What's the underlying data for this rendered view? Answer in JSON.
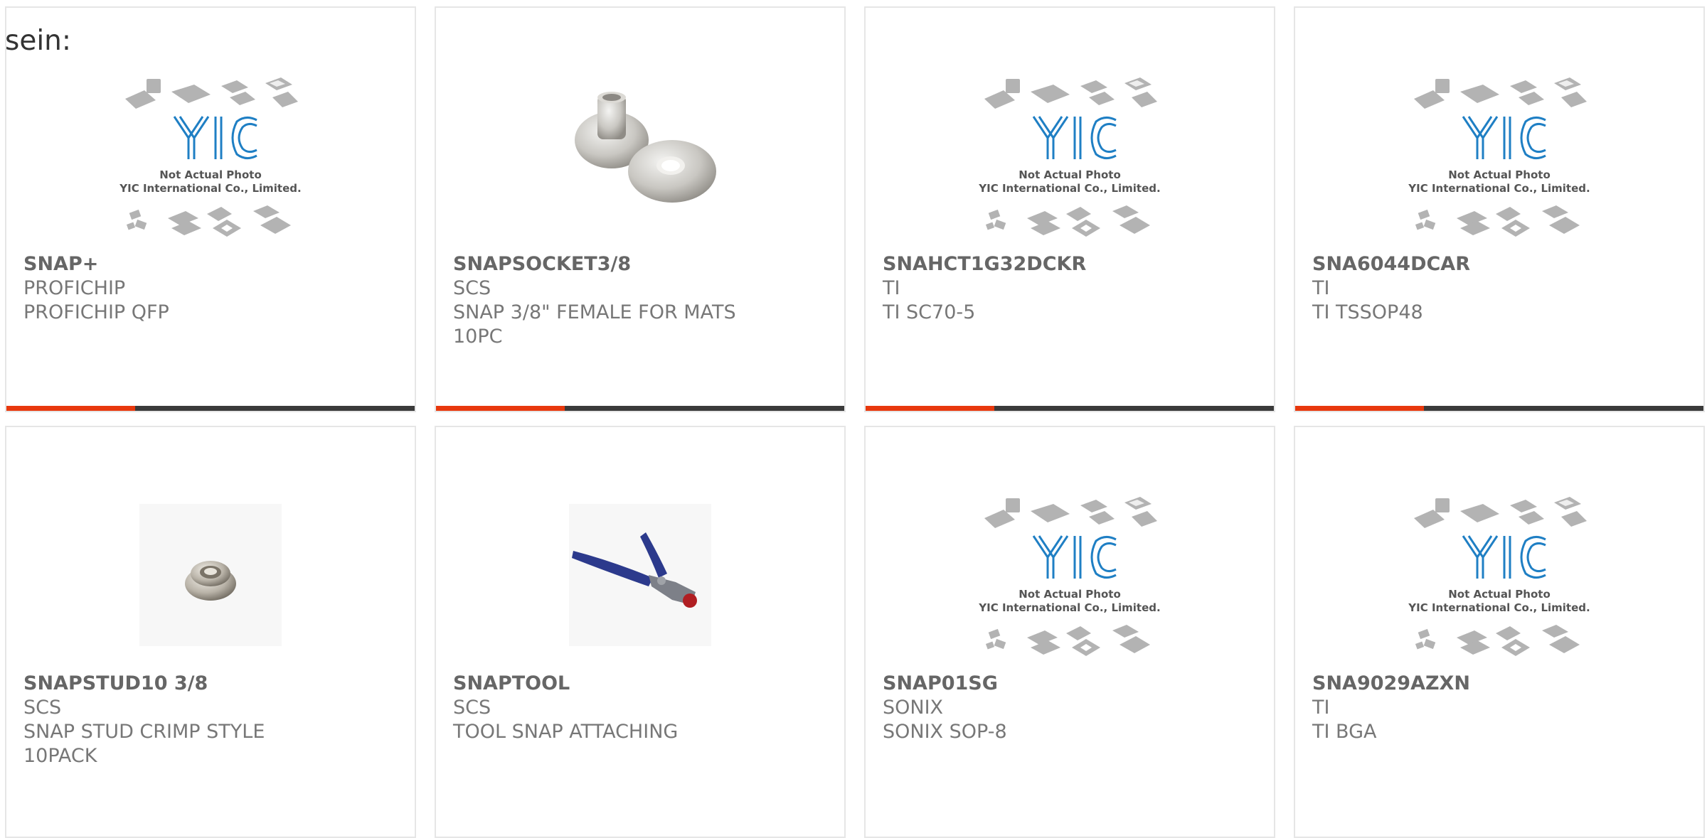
{
  "top_label": "sein:",
  "products": [
    {
      "part": "SNAP+",
      "mfr": "PROFICHIP",
      "desc": "PROFICHIP QFP",
      "image": "yic-placeholder",
      "photo_note": "Not Actual Photo",
      "photo_company": "YIC International Co., Limited.",
      "logo_text": "YIC"
    },
    {
      "part": "SNAPSOCKET3/8",
      "mfr": "SCS",
      "desc": "SNAP 3/8\" FEMALE FOR MATS 10PC",
      "image": "snap-socket-photo"
    },
    {
      "part": "SNAHCT1G32DCKR",
      "mfr": "TI",
      "desc": "TI SC70-5",
      "image": "yic-placeholder",
      "photo_note": "Not Actual Photo",
      "photo_company": "YIC International Co., Limited.",
      "logo_text": "YIC"
    },
    {
      "part": "SNA6044DCAR",
      "mfr": "TI",
      "desc": "TI TSSOP48",
      "image": "yic-placeholder",
      "photo_note": "Not Actual Photo",
      "photo_company": "YIC International Co., Limited.",
      "logo_text": "YIC"
    },
    {
      "part": "SNAPSTUD10 3/8",
      "mfr": "SCS",
      "desc": "SNAP STUD CRIMP STYLE 10PACK",
      "image": "snap-stud-photo"
    },
    {
      "part": "SNAPTOOL",
      "mfr": "SCS",
      "desc": "TOOL SNAP ATTACHING",
      "image": "snap-tool-photo"
    },
    {
      "part": "SNAP01SG",
      "mfr": "SONIX",
      "desc": "SONIX SOP-8",
      "image": "yic-placeholder",
      "photo_note": "Not Actual Photo",
      "photo_company": "YIC International Co., Limited.",
      "logo_text": "YIC"
    },
    {
      "part": "SNA9029AZXN",
      "mfr": "TI",
      "desc": "TI BGA",
      "image": "yic-placeholder",
      "photo_note": "Not Actual Photo",
      "photo_company": "YIC International Co., Limited.",
      "logo_text": "YIC"
    }
  ],
  "colors": {
    "accent": "#e8380d",
    "bar_dark": "#3a3a3a",
    "text_bold": "#666666",
    "text": "#777777",
    "card_border": "#e6e6e6",
    "logo_blue": "#1f7fc4"
  }
}
